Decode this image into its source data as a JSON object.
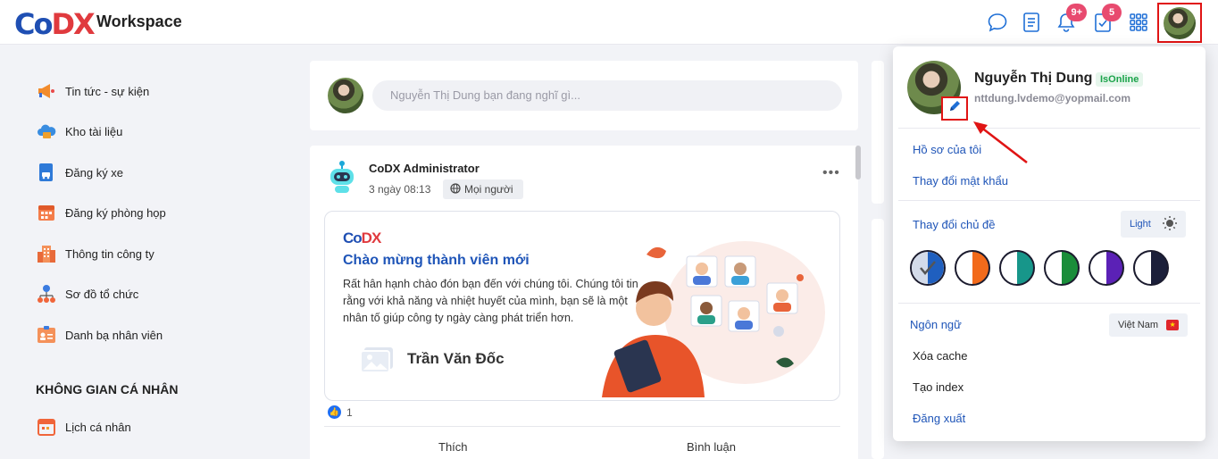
{
  "header": {
    "logo_text": "CoDX",
    "app_name": "Workspace",
    "notifications_badge": "9+",
    "tasks_badge": "5"
  },
  "sidebar": {
    "items": [
      {
        "label": "Tin tức - sự kiện",
        "icon": "megaphone-icon"
      },
      {
        "label": "Kho tài liệu",
        "icon": "cloud-folder-icon"
      },
      {
        "label": "Đăng ký xe",
        "icon": "car-icon"
      },
      {
        "label": "Đăng ký phòng họp",
        "icon": "calendar-icon"
      },
      {
        "label": "Thông tin công ty",
        "icon": "building-icon"
      },
      {
        "label": "Sơ đồ tổ chức",
        "icon": "org-chart-icon"
      },
      {
        "label": "Danh bạ nhân viên",
        "icon": "contact-card-icon"
      }
    ],
    "personal_section": "KHÔNG GIAN CÁ NHÂN",
    "personal_items": [
      {
        "label": "Lịch cá nhân",
        "icon": "personal-calendar-icon"
      }
    ]
  },
  "composer": {
    "placeholder": "Nguyễn Thị Dung bạn đang nghĩ gì..."
  },
  "post": {
    "author": "CoDX Administrator",
    "time": "3 ngày 08:13",
    "privacy": "Mọi người",
    "more": "•••",
    "banner": {
      "logo": "CoDX",
      "title": "Chào mừng thành viên mới",
      "text": "Rất hân hạnh chào đón bạn đến với chúng tôi. Chúng tôi tin rằng với khả năng và nhiệt huyết của mình, bạn sẽ là một nhân tố giúp công ty ngày càng phát triển hơn.",
      "member_name": "Trần Văn Đốc"
    },
    "likes": "1",
    "actions": {
      "like": "Thích",
      "comment": "Bình luận"
    }
  },
  "profile_menu": {
    "name": "Nguyễn Thị Dung",
    "status": "IsOnline",
    "email": "nttdung.lvdemo@yopmail.com",
    "my_profile": "Hồ sơ của tôi",
    "change_password": "Thay đổi mật khẩu",
    "change_theme": "Thay đổi chủ đề",
    "theme_mode": "Light",
    "theme_colors": [
      "#1f5fbf",
      "#f26a1b",
      "#17968a",
      "#1a8d3a",
      "#5b21b6",
      "#1b1f3a"
    ],
    "language_label": "Ngôn ngữ",
    "language_value": "Việt Nam",
    "clear_cache": "Xóa cache",
    "create_index": "Tạo index",
    "logout": "Đăng xuất"
  }
}
